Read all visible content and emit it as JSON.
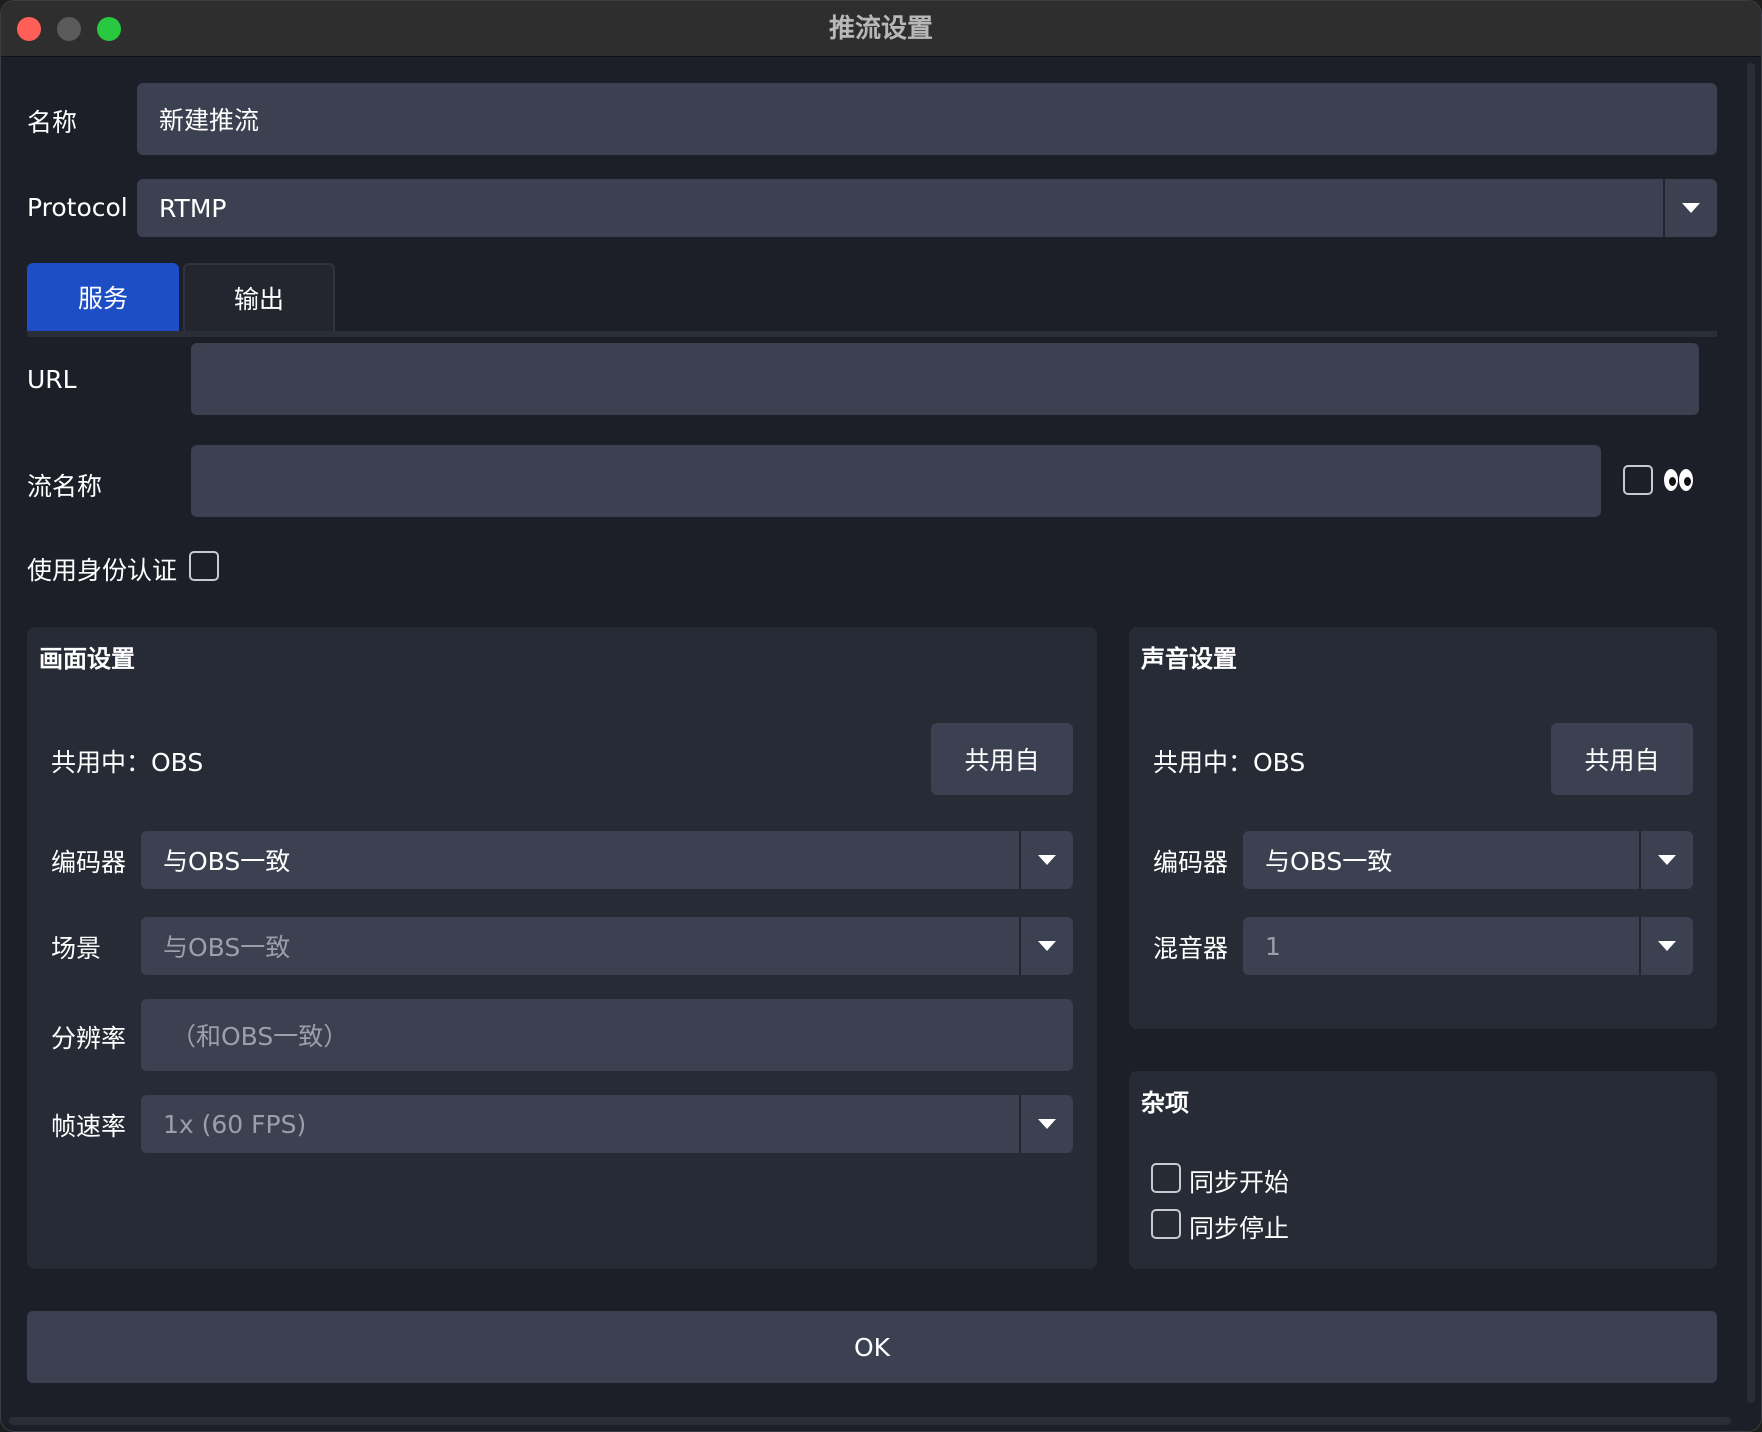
{
  "window": {
    "title": "推流设置"
  },
  "form": {
    "name_label": "名称",
    "name_value": "新建推流",
    "protocol_label": "Protocol",
    "protocol_value": "RTMP"
  },
  "tabs": [
    {
      "label": "服务",
      "active": true
    },
    {
      "label": "输出",
      "active": false
    }
  ],
  "service": {
    "url_label": "URL",
    "url_value": "",
    "stream_key_label": "流名称",
    "stream_key_value": "",
    "auth_label": "使用身份认证",
    "auth_checked": false
  },
  "video": {
    "title": "画面设置",
    "sharing_text": "共用中：OBS",
    "share_button": "共用自",
    "encoder_label": "编码器",
    "encoder_value": "与OBS一致",
    "scene_label": "场景",
    "scene_value": "与OBS一致",
    "resolution_label": "分辨率",
    "resolution_placeholder": "（和OBS一致）",
    "fps_label": "帧速率",
    "fps_value": "1x (60 FPS)"
  },
  "audio": {
    "title": "声音设置",
    "sharing_text": "共用中：OBS",
    "share_button": "共用自",
    "encoder_label": "编码器",
    "encoder_value": "与OBS一致",
    "mixer_label": "混音器",
    "mixer_value": "1"
  },
  "misc": {
    "title": "杂项",
    "sync_start_label": "同步开始",
    "sync_start_checked": false,
    "sync_stop_label": "同步停止",
    "sync_stop_checked": false
  },
  "ok_button": "OK",
  "colors": {
    "accent": "#1d4ec6",
    "field": "#3b4150",
    "panel": "#272b35",
    "background": "#1c1f27"
  }
}
